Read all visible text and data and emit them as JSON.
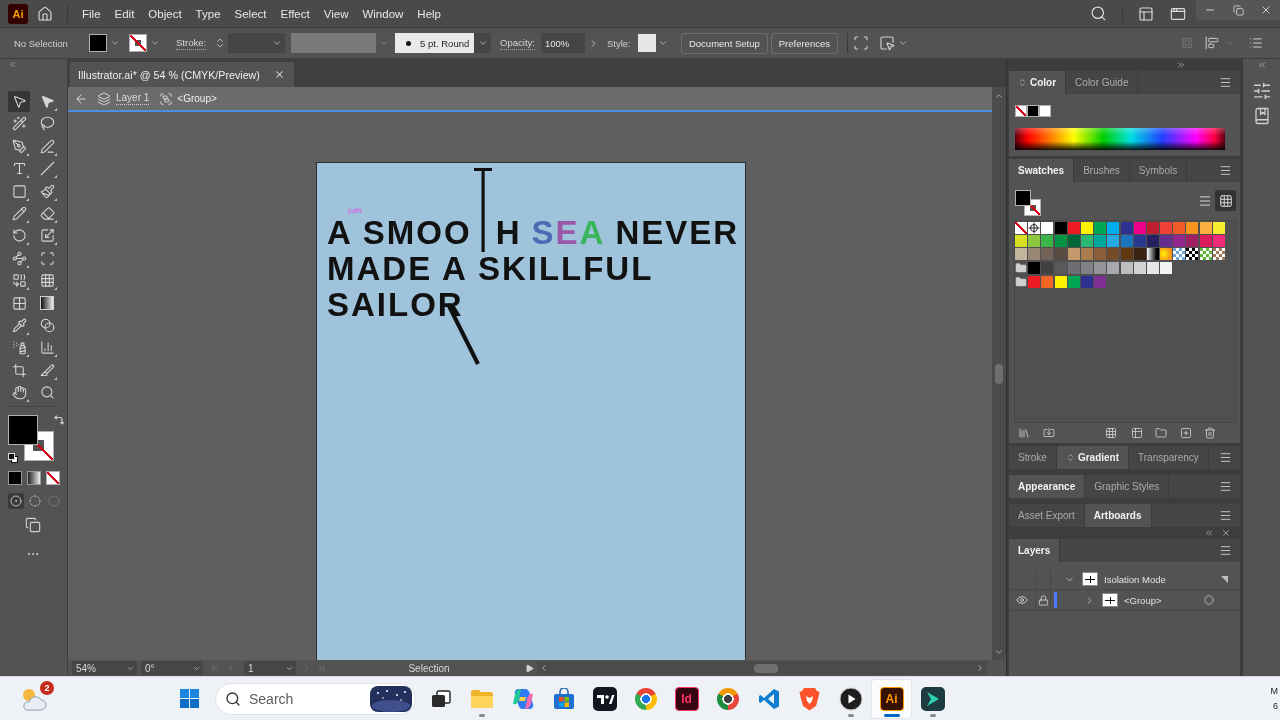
{
  "app": {
    "logo": "Ai"
  },
  "menu": [
    "File",
    "Edit",
    "Object",
    "Type",
    "Select",
    "Effect",
    "View",
    "Window",
    "Help"
  ],
  "control_bar": {
    "selection": "No Selection",
    "fill": {
      "kind": "solid",
      "color": "#000000"
    },
    "stroke": {
      "kind": "none"
    },
    "stroke_label": "Stroke:",
    "brush": "5 pt. Round",
    "opacity_label": "Opacity:",
    "opacity": "100%",
    "style_label": "Style:",
    "buttons": [
      "Document Setup",
      "Preferences"
    ]
  },
  "document": {
    "tab": "Illustrator.ai* @ 54 % (CMYK/Preview)",
    "breadcrumb": [
      "Layer 1",
      "<Group>"
    ]
  },
  "artboard": {
    "lines": [
      [
        {
          "parts": [
            {
              "kind": "text",
              "text": "A",
              "color": "#111111"
            }
          ]
        },
        {
          "parts": [
            {
              "kind": "text",
              "text": "SMOO",
              "color": "#111111"
            },
            {
              "kind": "stroke"
            },
            {
              "kind": "text",
              "text": "H",
              "color": "#111111"
            }
          ]
        },
        {
          "parts": [
            {
              "kind": "text",
              "text": "S",
              "color": "#4a6cb5"
            },
            {
              "kind": "text",
              "text": "E",
              "color": "#9a58a8"
            },
            {
              "kind": "text",
              "text": "A",
              "color": "#3bb55c"
            }
          ]
        },
        {
          "parts": [
            {
              "kind": "text",
              "text": "NEVER",
              "color": "#111111"
            }
          ]
        }
      ],
      [
        {
          "parts": [
            {
              "kind": "text",
              "text": "MADE A SKILLFUL",
              "color": "#111111"
            }
          ]
        }
      ],
      [
        {
          "parts": [
            {
              "kind": "text",
              "text": "SAILOR",
              "color": "#111111"
            }
          ]
        }
      ]
    ],
    "strokes": [
      {
        "kind": "diagonal"
      }
    ],
    "smart_guide": "path"
  },
  "tools": [
    {
      "kind": "selection",
      "selected": true,
      "flyout": false
    },
    {
      "kind": "direct-selection",
      "selected": false,
      "flyout": true
    },
    {
      "kind": "magic-wand",
      "selected": false,
      "flyout": false
    },
    {
      "kind": "lasso",
      "selected": false,
      "flyout": false
    },
    {
      "kind": "pen",
      "selected": false,
      "flyout": true
    },
    {
      "kind": "curvature",
      "selected": false,
      "flyout": true
    },
    {
      "kind": "type",
      "selected": false,
      "flyout": true
    },
    {
      "kind": "line",
      "selected": false,
      "flyout": true
    },
    {
      "kind": "rectangle",
      "selected": false,
      "flyout": true
    },
    {
      "kind": "paintbrush",
      "selected": false,
      "flyout": true
    },
    {
      "kind": "shaper",
      "selected": false,
      "flyout": true
    },
    {
      "kind": "eraser",
      "selected": false,
      "flyout": true
    },
    {
      "kind": "rotate",
      "selected": false,
      "flyout": true
    },
    {
      "kind": "scale",
      "selected": false,
      "flyout": true
    },
    {
      "kind": "puppet-warp",
      "selected": false,
      "flyout": true
    },
    {
      "kind": "free-transform",
      "selected": false,
      "flyout": false
    },
    {
      "kind": "shape-builder",
      "selected": false,
      "flyout": true
    },
    {
      "kind": "perspective",
      "selected": false,
      "flyout": true
    },
    {
      "kind": "mesh",
      "selected": false,
      "flyout": false
    },
    {
      "kind": "gradient",
      "selected": false,
      "flyout": false
    },
    {
      "kind": "eyedropper",
      "selected": false,
      "flyout": true
    },
    {
      "kind": "blend",
      "selected": false,
      "flyout": false
    },
    {
      "kind": "symbol-sprayer",
      "selected": false,
      "flyout": true
    },
    {
      "kind": "graph",
      "selected": false,
      "flyout": true
    },
    {
      "kind": "artboard",
      "selected": false,
      "flyout": false
    },
    {
      "kind": "slice",
      "selected": false,
      "flyout": true
    },
    {
      "kind": "hand",
      "selected": false,
      "flyout": true
    },
    {
      "kind": "zoom",
      "selected": false,
      "flyout": false
    }
  ],
  "fill_stroke": {
    "fill": {
      "kind": "solid",
      "color": "#000000"
    },
    "stroke": {
      "kind": "none"
    }
  },
  "color_modes": [
    {
      "kind": "color",
      "color": "#000000"
    },
    {
      "kind": "gradient"
    },
    {
      "kind": "none"
    }
  ],
  "draw_modes": [
    {
      "kind": "normal",
      "selected": true,
      "disabled": false
    },
    {
      "kind": "behind",
      "selected": false,
      "disabled": false
    },
    {
      "kind": "inside",
      "selected": false,
      "disabled": true
    }
  ],
  "color_panel": {
    "tabs": [
      {
        "label": "Color",
        "selected": true,
        "options_icon": true
      },
      {
        "label": "Color Guide",
        "selected": false,
        "options_icon": false
      }
    ],
    "chips": [
      {
        "kind": "none"
      },
      {
        "kind": "solid",
        "color": "#000000"
      },
      {
        "kind": "solid",
        "color": "#ffffff"
      }
    ]
  },
  "swatches_panel": {
    "tabs": [
      {
        "label": "Swatches",
        "selected": true
      },
      {
        "label": "Brushes",
        "selected": false
      },
      {
        "label": "Symbols",
        "selected": false
      }
    ],
    "fill": {
      "kind": "solid",
      "color": "#000000"
    },
    "stroke": {
      "kind": "none"
    },
    "views": [
      {
        "kind": "list",
        "selected": false
      },
      {
        "kind": "grid",
        "selected": true
      }
    ],
    "rows": [
      [
        {
          "kind": "none"
        },
        {
          "kind": "registration"
        },
        {
          "kind": "solid",
          "color": "#ffffff"
        },
        {
          "kind": "solid",
          "color": "#000000"
        },
        {
          "kind": "solid",
          "color": "#ed1c24"
        },
        {
          "kind": "solid",
          "color": "#fff200"
        },
        {
          "kind": "solid",
          "color": "#00a651"
        },
        {
          "kind": "solid",
          "color": "#00aeef"
        },
        {
          "kind": "solid",
          "color": "#2e3192"
        },
        {
          "kind": "solid",
          "color": "#ec008c"
        },
        {
          "kind": "solid",
          "color": "#be1e2d"
        },
        {
          "kind": "solid",
          "color": "#ef4136"
        },
        {
          "kind": "solid",
          "color": "#f15a29"
        },
        {
          "kind": "solid",
          "color": "#f7941d"
        },
        {
          "kind": "solid",
          "color": "#fbb040"
        },
        {
          "kind": "solid",
          "color": "#f9ed32"
        }
      ],
      [
        {
          "kind": "solid",
          "color": "#d7df23"
        },
        {
          "kind": "solid",
          "color": "#8dc63f"
        },
        {
          "kind": "solid",
          "color": "#39b54a"
        },
        {
          "kind": "solid",
          "color": "#009444"
        },
        {
          "kind": "solid",
          "color": "#006838"
        },
        {
          "kind": "solid",
          "color": "#2bb673"
        },
        {
          "kind": "solid",
          "color": "#00a79d"
        },
        {
          "kind": "solid",
          "color": "#27aae1"
        },
        {
          "kind": "solid",
          "color": "#1c75bc"
        },
        {
          "kind": "solid",
          "color": "#2b3990"
        },
        {
          "kind": "solid",
          "color": "#262262"
        },
        {
          "kind": "solid",
          "color": "#662d91"
        },
        {
          "kind": "solid",
          "color": "#92278f"
        },
        {
          "kind": "solid",
          "color": "#9e1f63"
        },
        {
          "kind": "solid",
          "color": "#da1c5c"
        },
        {
          "kind": "solid",
          "color": "#ee2a7b"
        }
      ],
      [
        {
          "kind": "solid",
          "color": "#c2b59b"
        },
        {
          "kind": "solid",
          "color": "#998675"
        },
        {
          "kind": "solid",
          "color": "#736357"
        },
        {
          "kind": "solid",
          "color": "#594a42"
        },
        {
          "kind": "solid",
          "color": "#c49a6c"
        },
        {
          "kind": "solid",
          "color": "#a97c50"
        },
        {
          "kind": "solid",
          "color": "#8b5e3c"
        },
        {
          "kind": "solid",
          "color": "#754c29"
        },
        {
          "kind": "solid",
          "color": "#603913"
        },
        {
          "kind": "solid",
          "color": "#3c2415"
        },
        {
          "kind": "gradient",
          "color": "#000000"
        },
        {
          "kind": "radial-gradient",
          "color": "#f7941d"
        },
        {
          "kind": "pattern",
          "color": "#6fa8dc"
        },
        {
          "kind": "pattern",
          "color": "#000000"
        },
        {
          "kind": "pattern",
          "color": "#5cb83a"
        },
        {
          "kind": "pattern",
          "color": "#a0785a"
        }
      ],
      [
        {
          "kind": "folder"
        },
        {
          "kind": "solid",
          "color": "#000000"
        },
        {
          "kind": "solid",
          "color": "#414042"
        },
        {
          "kind": "solid",
          "color": "#58595b"
        },
        {
          "kind": "solid",
          "color": "#6d6e71"
        },
        {
          "kind": "solid",
          "color": "#808285"
        },
        {
          "kind": "solid",
          "color": "#939598"
        },
        {
          "kind": "solid",
          "color": "#a7a9ac"
        },
        {
          "kind": "solid",
          "color": "#bcbec0"
        },
        {
          "kind": "solid",
          "color": "#d1d3d4"
        },
        {
          "kind": "solid",
          "color": "#e6e7e8"
        },
        {
          "kind": "solid",
          "color": "#f1f2f2"
        }
      ],
      [
        {
          "kind": "folder"
        },
        {
          "kind": "solid",
          "color": "#ed1c24"
        },
        {
          "kind": "solid",
          "color": "#f26522"
        },
        {
          "kind": "solid",
          "color": "#fff200"
        },
        {
          "kind": "solid",
          "color": "#00a651"
        },
        {
          "kind": "solid",
          "color": "#2e3192"
        },
        {
          "kind": "solid",
          "color": "#7f2f93"
        }
      ]
    ]
  },
  "stroke_tabs": [
    {
      "label": "Stroke",
      "selected": false,
      "options_icon": false
    },
    {
      "label": "Gradient",
      "selected": true,
      "options_icon": true
    },
    {
      "label": "Transparency",
      "selected": false,
      "options_icon": false
    }
  ],
  "appearance_tabs": [
    {
      "label": "Appearance",
      "selected": true
    },
    {
      "label": "Graphic Styles",
      "selected": false
    }
  ],
  "export_tabs": [
    {
      "label": "Asset Export",
      "selected": false
    },
    {
      "label": "Artboards",
      "selected": true
    }
  ],
  "layers_panel": {
    "tabs": [
      {
        "label": "Layers",
        "selected": true
      }
    ],
    "rows": [
      {
        "kind": "isolation",
        "name": "Isolation Mode",
        "expanded": true,
        "visible": false,
        "locked": false,
        "children": [
          {
            "kind": "sublayer",
            "name": "<Group>",
            "expanded": false,
            "visible": true,
            "locked": true
          }
        ]
      }
    ]
  },
  "status_bar": {
    "zoom": "54%",
    "rotation": "0°",
    "artboard": "1",
    "status": "Selection"
  },
  "taskbar": {
    "weather": {
      "badge": "2"
    },
    "search": {
      "placeholder": "Search"
    },
    "apps": [
      {
        "kind": "folder",
        "open": true,
        "selected": false
      },
      {
        "kind": "swirl",
        "open": false,
        "selected": false
      },
      {
        "kind": "bag",
        "open": false,
        "selected": false
      },
      {
        "kind": "tv",
        "open": false,
        "selected": false
      },
      {
        "kind": "browser",
        "open": false,
        "selected": false
      },
      {
        "kind": "letter-tile",
        "label": "Id",
        "color": "#ff3366",
        "open": false,
        "selected": false
      },
      {
        "kind": "browser-alt",
        "open": false,
        "selected": false
      },
      {
        "kind": "ribbon",
        "open": false,
        "selected": false
      },
      {
        "kind": "shield",
        "open": false,
        "selected": false
      },
      {
        "kind": "play",
        "open": true,
        "selected": false
      },
      {
        "kind": "letter-tile",
        "label": "Ai",
        "color": "#ff9a00",
        "open": true,
        "selected": true
      },
      {
        "kind": "teal",
        "open": true,
        "selected": false
      }
    ],
    "clock": {
      "time": "M",
      "date": "6"
    }
  }
}
